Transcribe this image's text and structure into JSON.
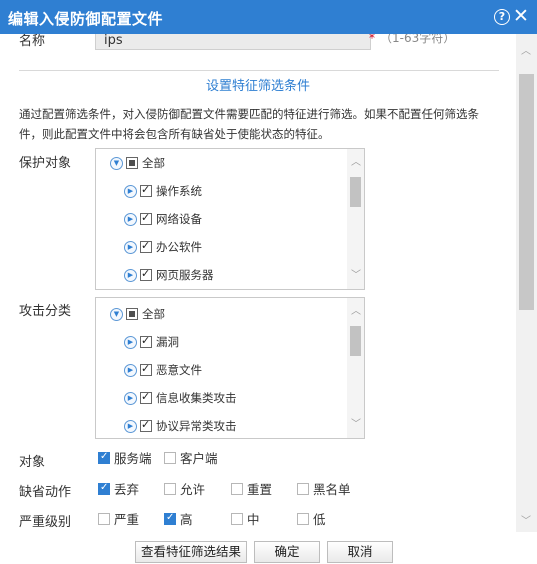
{
  "dialog": {
    "title": "编辑入侵防御配置文件",
    "help_icon": "?",
    "close_icon": "✕"
  },
  "name_field": {
    "label": "名称",
    "value": "ips",
    "hint": "（1-63字符）"
  },
  "section": {
    "title": "设置特征筛选条件",
    "description": "通过配置筛选条件，对入侵防御配置文件需要匹配的特征进行筛选。如果不配置任何筛选条件，则此配置文件中将会包含所有缺省处于使能状态的特征。"
  },
  "protect_target": {
    "label": "保护对象",
    "root": {
      "label": "全部",
      "state": "partial"
    },
    "items": [
      {
        "label": "操作系统",
        "checked": true
      },
      {
        "label": "网络设备",
        "checked": true
      },
      {
        "label": "办公软件",
        "checked": true
      },
      {
        "label": "网页服务器",
        "checked": true
      }
    ]
  },
  "attack_category": {
    "label": "攻击分类",
    "root": {
      "label": "全部",
      "state": "partial"
    },
    "items": [
      {
        "label": "漏洞",
        "checked": true
      },
      {
        "label": "恶意文件",
        "checked": true
      },
      {
        "label": "信息收集类攻击",
        "checked": true
      },
      {
        "label": "协议异常类攻击",
        "checked": true
      }
    ]
  },
  "target": {
    "label": "对象",
    "options": [
      {
        "label": "服务端",
        "checked": true
      },
      {
        "label": "客户端",
        "checked": false
      }
    ]
  },
  "default_action": {
    "label": "缺省动作",
    "options": [
      {
        "label": "丢弃",
        "checked": true
      },
      {
        "label": "允许",
        "checked": false
      },
      {
        "label": "重置",
        "checked": false
      },
      {
        "label": "黑名单",
        "checked": false
      }
    ]
  },
  "severity": {
    "label": "严重级别",
    "options": [
      {
        "label": "严重",
        "checked": false
      },
      {
        "label": "高",
        "checked": true
      },
      {
        "label": "中",
        "checked": false
      },
      {
        "label": "低",
        "checked": false
      }
    ]
  },
  "buttons": {
    "view_results": "查看特征筛选结果",
    "ok": "确定",
    "cancel": "取消"
  },
  "colors": {
    "titlebar": "#2f7fd2",
    "accent": "#2f7fd2"
  }
}
